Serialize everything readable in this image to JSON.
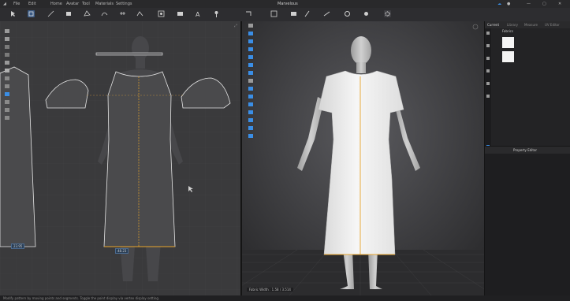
{
  "window": {
    "title": "Marvelous"
  },
  "menu": [
    "File",
    "Edit",
    "Home",
    "Avatar",
    "Tool",
    "Materials",
    "Settings"
  ],
  "panel_tabs": [
    "Current",
    "Library",
    "Measure",
    "UV Editor"
  ],
  "object_browser": {
    "section": "Fabrics"
  },
  "property_editor": {
    "title": "Property Editor"
  },
  "measurements_2d": {
    "left_piece": "23.95",
    "bottom_center": "48.23"
  },
  "viewport_3d": {
    "label": "Fabric Width : 1.58 / 3.514"
  },
  "status": {
    "text": "Modify pattern by moving points and segments. Toggle the point display via vertex display setting."
  },
  "colors": {
    "accent": "#3a8ee6",
    "seam": "#e8a52d",
    "grid": "#444446",
    "garment": "#f2f2f2"
  }
}
